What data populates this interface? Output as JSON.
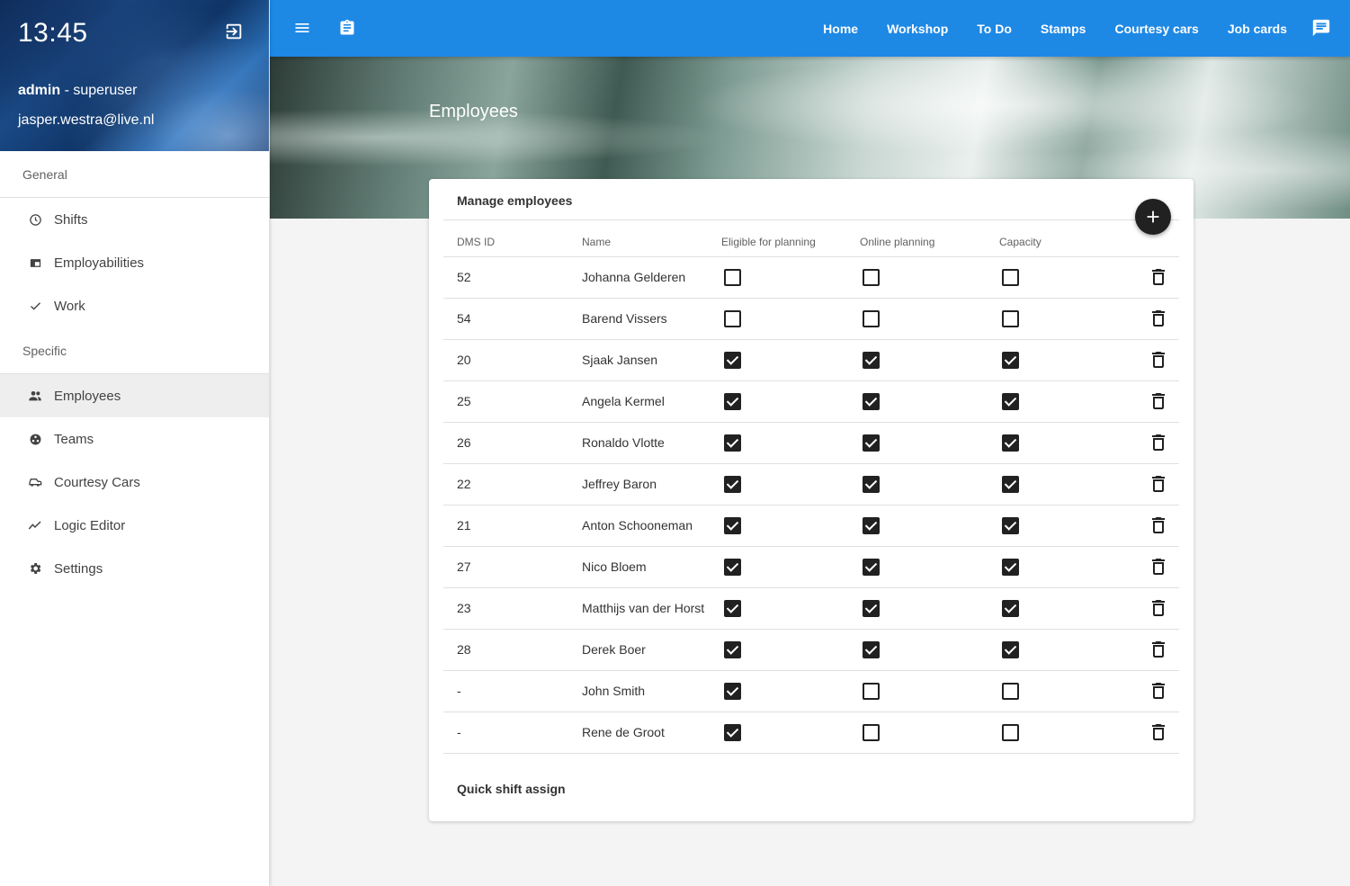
{
  "sidebar": {
    "clock": "13:45",
    "user_name": "admin",
    "user_role": " - superuser",
    "user_email": "jasper.westra@live.nl",
    "section_general": "General",
    "section_specific": "Specific",
    "general_items": [
      {
        "label": "Shifts",
        "icon": "clock-icon"
      },
      {
        "label": "Employabilities",
        "icon": "card-icon"
      },
      {
        "label": "Work",
        "icon": "check-icon"
      }
    ],
    "specific_items": [
      {
        "label": "Employees",
        "icon": "people-icon",
        "active": true
      },
      {
        "label": "Teams",
        "icon": "teams-icon"
      },
      {
        "label": "Courtesy Cars",
        "icon": "car-icon"
      },
      {
        "label": "Logic Editor",
        "icon": "trend-icon"
      },
      {
        "label": "Settings",
        "icon": "gear-icon"
      }
    ]
  },
  "topbar": {
    "nav": [
      "Home",
      "Workshop",
      "To Do",
      "Stamps",
      "Courtesy cars",
      "Job cards"
    ],
    "accent": "#1e88e5"
  },
  "page": {
    "title": "Employees"
  },
  "card": {
    "title": "Manage employees",
    "footer": "Quick shift assign",
    "columns": [
      "DMS ID",
      "Name",
      "Eligible for planning",
      "Online planning",
      "Capacity"
    ],
    "rows": [
      {
        "id": "52",
        "name": "Johanna Gelderen",
        "eligible": false,
        "online": false,
        "capacity": false
      },
      {
        "id": "54",
        "name": "Barend Vissers",
        "eligible": false,
        "online": false,
        "capacity": false
      },
      {
        "id": "20",
        "name": "Sjaak Jansen",
        "eligible": true,
        "online": true,
        "capacity": true
      },
      {
        "id": "25",
        "name": "Angela Kermel",
        "eligible": true,
        "online": true,
        "capacity": true
      },
      {
        "id": "26",
        "name": "Ronaldo Vlotte",
        "eligible": true,
        "online": true,
        "capacity": true
      },
      {
        "id": "22",
        "name": "Jeffrey Baron",
        "eligible": true,
        "online": true,
        "capacity": true
      },
      {
        "id": "21",
        "name": "Anton Schooneman",
        "eligible": true,
        "online": true,
        "capacity": true
      },
      {
        "id": "27",
        "name": "Nico Bloem",
        "eligible": true,
        "online": true,
        "capacity": true
      },
      {
        "id": "23",
        "name": "Matthijs van der Horst",
        "eligible": true,
        "online": true,
        "capacity": true
      },
      {
        "id": "28",
        "name": "Derek Boer",
        "eligible": true,
        "online": true,
        "capacity": true
      },
      {
        "id": "-",
        "name": "John Smith",
        "eligible": true,
        "online": false,
        "capacity": false
      },
      {
        "id": "-",
        "name": "Rene de Groot",
        "eligible": true,
        "online": false,
        "capacity": false
      }
    ]
  }
}
